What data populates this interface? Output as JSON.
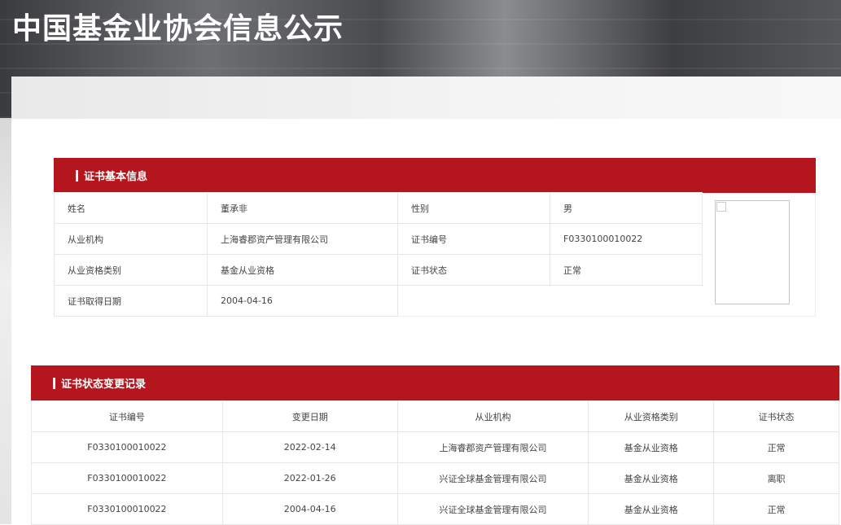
{
  "header": {
    "title": "中国基金业协会信息公示"
  },
  "basic": {
    "title": "证书基本信息",
    "rows": [
      [
        "姓名",
        "董承非",
        "性别",
        "男"
      ],
      [
        "从业机构",
        "上海睿郡资产管理有限公司",
        "证书编号",
        "F0330100010022"
      ],
      [
        "从业资格类别",
        "基金从业资格",
        "证书状态",
        "正常"
      ],
      [
        "证书取得日期",
        "2004-04-16"
      ]
    ]
  },
  "history": {
    "title": "证书状态变更记录",
    "columns": [
      "证书编号",
      "变更日期",
      "从业机构",
      "从业资格类别",
      "证书状态"
    ],
    "rows": [
      [
        "F0330100010022",
        "2022-02-14",
        "上海睿郡资产管理有限公司",
        "基金从业资格",
        "正常"
      ],
      [
        "F0330100010022",
        "2022-01-26",
        "兴证全球基金管理有限公司",
        "基金从业资格",
        "离职"
      ],
      [
        "F0330100010022",
        "2004-04-16",
        "兴证全球基金管理有限公司",
        "基金从业资格",
        "正常"
      ]
    ]
  },
  "colors": {
    "accent": "#b5161e"
  }
}
